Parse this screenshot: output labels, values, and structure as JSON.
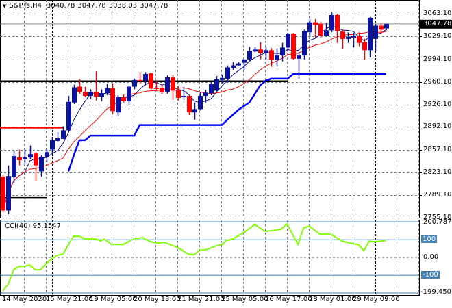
{
  "header": {
    "symbol": "S&P.fs,H4",
    "open": "3040.78",
    "high": "3047.78",
    "low": "3038.03",
    "close": "3047.78"
  },
  "price_axis": {
    "labels": [
      "3063.10",
      "3029.10",
      "2994.10",
      "2960.10",
      "2926.10",
      "2892.10",
      "2857.10",
      "2823.10",
      "2789.10",
      "2755.10"
    ],
    "current_price": "3047.78"
  },
  "cci": {
    "title": "CCI(40) 95.1547",
    "axis_labels": {
      "top": "200.787",
      "p100": "100",
      "zero": "0.00",
      "m100": "-100",
      "bottom": "-199.4507"
    },
    "levels": [
      100,
      -100
    ],
    "range": [
      -199.4507,
      200.787
    ],
    "points": [
      [
        0,
        -188
      ],
      [
        1,
        -150
      ],
      [
        2,
        -69
      ],
      [
        3,
        -50
      ],
      [
        4,
        -50
      ],
      [
        4.9,
        -42
      ],
      [
        5.9,
        -69
      ],
      [
        6.9,
        -69
      ],
      [
        7.9,
        -35
      ],
      [
        8.9,
        -8
      ],
      [
        9.9,
        12
      ],
      [
        11,
        19
      ],
      [
        12.1,
        77
      ],
      [
        12.9,
        119
      ],
      [
        14,
        119
      ],
      [
        15,
        104
      ],
      [
        17,
        104
      ],
      [
        17.9,
        92
      ],
      [
        18.5,
        104
      ],
      [
        19.9,
        73
      ],
      [
        22,
        73
      ],
      [
        23.9,
        104
      ],
      [
        25.5,
        112
      ],
      [
        27,
        88
      ],
      [
        28.3,
        81
      ],
      [
        29.5,
        85
      ],
      [
        31.8,
        58
      ],
      [
        33.9,
        19
      ],
      [
        34.9,
        15
      ],
      [
        36,
        42
      ],
      [
        37,
        42
      ],
      [
        38.9,
        65
      ],
      [
        40.1,
        73
      ],
      [
        40.75,
        96
      ],
      [
        42,
        104
      ],
      [
        44,
        140
      ],
      [
        46,
        185
      ],
      [
        47.9,
        146
      ],
      [
        50.75,
        158
      ],
      [
        51.9,
        188
      ],
      [
        53.9,
        73
      ],
      [
        54.9,
        165
      ],
      [
        55.9,
        177
      ],
      [
        57.9,
        131
      ],
      [
        59.9,
        131
      ],
      [
        61.9,
        92
      ],
      [
        63.9,
        77
      ],
      [
        64.9,
        73
      ],
      [
        65.9,
        38
      ],
      [
        66.9,
        92
      ],
      [
        67.9,
        88
      ],
      [
        69.9,
        95
      ]
    ]
  },
  "time_axis": {
    "labels": [
      {
        "text": "14 May 2020",
        "index": 0
      },
      {
        "text": "15 May 21:00",
        "index": 8
      },
      {
        "text": "19 May 05:00",
        "index": 16
      },
      {
        "text": "20 May 13:00",
        "index": 24
      },
      {
        "text": "21 May 21:00",
        "index": 32
      },
      {
        "text": "25 May 05:00",
        "index": 40
      },
      {
        "text": "26 May 17:00",
        "index": 48
      },
      {
        "text": "28 May 01:00",
        "index": 56
      },
      {
        "text": "29 May 09:00",
        "index": 64
      }
    ],
    "separators": [
      9,
      68
    ]
  },
  "colors": {
    "bull": "#0a14a0",
    "bear": "#ff0000",
    "cci": "#80ff00",
    "level": "#4682b4",
    "stepline": "#0000ff",
    "grid": "#708090"
  },
  "chart_data": {
    "type": "candlestick",
    "ylim": [
      2755.1,
      3063.1
    ],
    "candles_ohlc": [
      [
        2817,
        2820,
        2763,
        2766
      ],
      [
        2766,
        2834,
        2760,
        2818
      ],
      [
        2817,
        2855,
        2807,
        2848
      ],
      [
        2846,
        2858,
        2834,
        2842
      ],
      [
        2843,
        2858,
        2836,
        2846
      ],
      [
        2846,
        2864,
        2843,
        2851
      ],
      [
        2852,
        2854,
        2811,
        2834
      ],
      [
        2825,
        2849,
        2817,
        2847
      ],
      [
        2847,
        2858,
        2839,
        2854
      ],
      [
        2858,
        2877,
        2851,
        2872
      ],
      [
        2871,
        2884,
        2870,
        2875
      ],
      [
        2874,
        2893,
        2874,
        2887
      ],
      [
        2887,
        2939,
        2885,
        2930
      ],
      [
        2929,
        2956,
        2927,
        2952
      ],
      [
        2953,
        2964,
        2942,
        2945
      ],
      [
        2945,
        2953,
        2937,
        2939
      ],
      [
        2939,
        2949,
        2934,
        2945
      ],
      [
        2945,
        2976,
        2932,
        2938
      ],
      [
        2938,
        2949,
        2931,
        2943
      ],
      [
        2943,
        2957,
        2940,
        2951
      ],
      [
        2951,
        2958,
        2911,
        2916
      ],
      [
        2914,
        2940,
        2908,
        2937
      ],
      [
        2937,
        2941,
        2929,
        2931
      ],
      [
        2931,
        2955,
        2926,
        2953
      ],
      [
        2953,
        2965,
        2949,
        2963
      ],
      [
        2963,
        2975,
        2957,
        2961
      ],
      [
        2962,
        2975,
        2955,
        2972
      ],
      [
        2973,
        2974,
        2949,
        2950
      ],
      [
        2951,
        2961,
        2946,
        2950
      ],
      [
        2951,
        2955,
        2942,
        2945
      ],
      [
        2945,
        2970,
        2942,
        2967
      ],
      [
        2967,
        2971,
        2933,
        2947
      ],
      [
        2948,
        2954,
        2932,
        2936
      ],
      [
        2937,
        2953,
        2933,
        2939
      ],
      [
        2939,
        2939,
        2910,
        2914
      ],
      [
        2914,
        2929,
        2903,
        2919
      ],
      [
        2919,
        2945,
        2917,
        2939
      ],
      [
        2939,
        2948,
        2929,
        2944
      ],
      [
        2943,
        2959,
        2940,
        2957
      ],
      [
        2947,
        2969,
        2946,
        2964
      ],
      [
        2963,
        2971,
        2958,
        2966
      ],
      [
        2965,
        2985,
        2959,
        2982
      ],
      [
        2981,
        2990,
        2978,
        2985
      ],
      [
        2985,
        2990,
        2984,
        2988
      ],
      [
        2989,
        2994,
        2978,
        2994
      ],
      [
        2994,
        3013,
        2992,
        3007
      ],
      [
        3006,
        3013,
        3005,
        3009
      ],
      [
        3009,
        3020,
        2994,
        3004
      ],
      [
        3004,
        3013,
        2994,
        3008
      ],
      [
        3008,
        3011,
        2983,
        2993
      ],
      [
        2993,
        3011,
        2983,
        3000
      ],
      [
        3000,
        3019,
        2991,
        3012
      ],
      [
        3012,
        3034,
        3008,
        3033
      ],
      [
        3033,
        3034,
        2994,
        2995
      ],
      [
        2995,
        3005,
        2965,
        3000
      ],
      [
        3000,
        3039,
        2994,
        3037
      ],
      [
        3035,
        3055,
        3030,
        3050
      ],
      [
        3050,
        3055,
        3027,
        3046
      ],
      [
        3048,
        3051,
        3027,
        3030
      ],
      [
        3030,
        3049,
        3029,
        3038
      ],
      [
        3038,
        3065,
        3035,
        3061
      ],
      [
        3061,
        3063,
        3019,
        3037
      ],
      [
        3036,
        3039,
        3010,
        3025
      ],
      [
        3025,
        3035,
        3019,
        3028
      ],
      [
        3027,
        3034,
        3012,
        3030
      ],
      [
        3029,
        3035,
        3014,
        3019
      ],
      [
        3020,
        3025,
        2993,
        3008
      ],
      [
        3008,
        3058,
        2997,
        3057
      ],
      [
        3025,
        3048,
        3007,
        3045
      ],
      [
        3045,
        3049,
        3033,
        3039
      ],
      [
        3040.78,
        3047.78,
        3038.03,
        3047.78
      ]
    ],
    "step_line": [
      [
        12,
        2825
      ],
      [
        13,
        2850
      ],
      [
        14,
        2872
      ],
      [
        15,
        2872
      ],
      [
        16,
        2879
      ],
      [
        24,
        2879
      ],
      [
        25,
        2895
      ],
      [
        40,
        2895
      ],
      [
        41,
        2903
      ],
      [
        43,
        2918
      ],
      [
        45,
        2929
      ],
      [
        47,
        2955
      ],
      [
        48,
        2962
      ],
      [
        49,
        2965
      ],
      [
        52,
        2965
      ],
      [
        53,
        2972
      ],
      [
        70,
        2972
      ]
    ],
    "hlines": [
      {
        "price": 2961,
        "from": 0,
        "to": 52,
        "color": "#000000"
      },
      {
        "price": 2891,
        "from": 0,
        "to": 11,
        "color": "#ff0000"
      },
      {
        "price": 2785,
        "from": 0,
        "to": 8,
        "color": "#000000"
      }
    ]
  }
}
